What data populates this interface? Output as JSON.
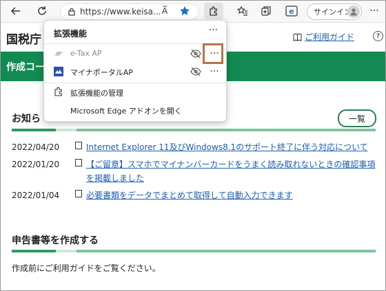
{
  "browser": {
    "url": "https://www.keisa...",
    "read_aloud_label": "A̅",
    "signin_label": "サインイン"
  },
  "page": {
    "site_title": "国税庁",
    "guide_link": "ご利用ガイド",
    "help_label": "?",
    "green_bar_text": "作成コー",
    "news_title": "お知ら",
    "list_button": "一覧",
    "news": [
      {
        "date": "2022/04/20",
        "lines": [
          "Internet Explorer 11及びWindows8.1のサポート終了に伴う対応について"
        ]
      },
      {
        "date": "2022/01/20",
        "lines": [
          "【ご留意】スマホでマイナンバーカードをうまく読み取れないときの確認事項",
          "を掲載しました"
        ]
      },
      {
        "date": "2022/01/04",
        "lines": [
          "必要書類をデータでまとめて取得して自動入力できます"
        ]
      }
    ],
    "create_title": "申告書等を作成する",
    "create_note": "作成前にご利用ガイドをご覧ください。"
  },
  "popup": {
    "title": "拡張機能",
    "more": "···",
    "extensions": [
      {
        "name": "e-Tax AP",
        "dim": true,
        "dots": "···"
      },
      {
        "name": "マイナポータルAP",
        "dim": false,
        "dots": "···"
      }
    ],
    "manage_label": "拡張機能の管理",
    "open_addons_label": "Microsoft Edge アドオンを開く"
  },
  "colors": {
    "green": "#138a52",
    "link": "#1a5db3",
    "highlight": "#b8724a"
  }
}
